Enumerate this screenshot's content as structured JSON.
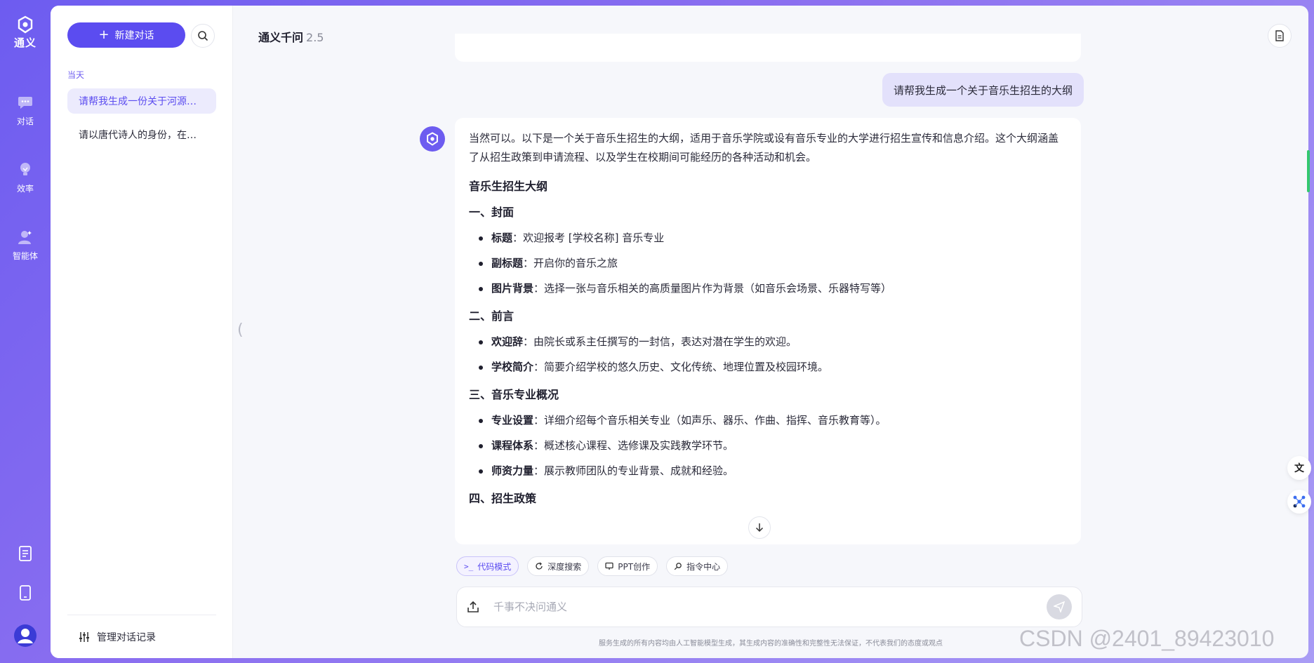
{
  "brand": {
    "name": "通义"
  },
  "rail": {
    "items": [
      {
        "label": "对话"
      },
      {
        "label": "效率"
      },
      {
        "label": "智能体"
      }
    ]
  },
  "sidebar": {
    "new_chat_label": "新建对话",
    "section_label": "当天",
    "history": [
      {
        "title": "请帮我生成一份关于河源某..."
      },
      {
        "title": "请以唐代诗人的身份，在面对"
      }
    ],
    "manage_label": "管理对话记录"
  },
  "header": {
    "title": "通义千问",
    "version": "2.5"
  },
  "chat": {
    "user_message": "请帮我生成一个关于音乐生招生的大纲",
    "answer": {
      "intro": "当然可以。以下是一个关于音乐生招生的大纲，适用于音乐学院或设有音乐专业的大学进行招生宣传和信息介绍。这个大纲涵盖了从招生政策到申请流程、以及学生在校期间可能经历的各种活动和机会。",
      "title": "音乐生招生大纲",
      "sections": [
        {
          "heading": "一、封面",
          "items": [
            {
              "term": "标题",
              "text": "：欢迎报考 [学校名称] 音乐专业"
            },
            {
              "term": "副标题",
              "text": "：开启你的音乐之旅"
            },
            {
              "term": "图片背景",
              "text": "：选择一张与音乐相关的高质量图片作为背景（如音乐会场景、乐器特写等）"
            }
          ]
        },
        {
          "heading": "二、前言",
          "items": [
            {
              "term": "欢迎辞",
              "text": "：由院长或系主任撰写的一封信，表达对潜在学生的欢迎。"
            },
            {
              "term": "学校简介",
              "text": "：简要介绍学校的悠久历史、文化传统、地理位置及校园环境。"
            }
          ]
        },
        {
          "heading": "三、音乐专业概况",
          "items": [
            {
              "term": "专业设置",
              "text": "：详细介绍每个音乐相关专业（如声乐、器乐、作曲、指挥、音乐教育等）。"
            },
            {
              "term": "课程体系",
              "text": "：概述核心课程、选修课及实践教学环节。"
            },
            {
              "term": "师资力量",
              "text": "：展示教师团队的专业背景、成就和经验。"
            }
          ]
        },
        {
          "heading": "四、招生政策",
          "items": []
        }
      ]
    }
  },
  "tools": [
    {
      "label": "代码模式"
    },
    {
      "label": "深度搜索"
    },
    {
      "label": "PPT创作"
    },
    {
      "label": "指令中心"
    }
  ],
  "input": {
    "placeholder": "千事不决问通义"
  },
  "footer_note": "服务生成的所有内容均由人工智能模型生成，其生成内容的准确性和完整性无法保证，不代表我们的态度或观点",
  "watermark": "CSDN @2401_89423010",
  "colors": {
    "accent": "#5b4cf0",
    "bubble": "#e3e1fb",
    "rail_gradient_start": "#6d5cf0"
  }
}
